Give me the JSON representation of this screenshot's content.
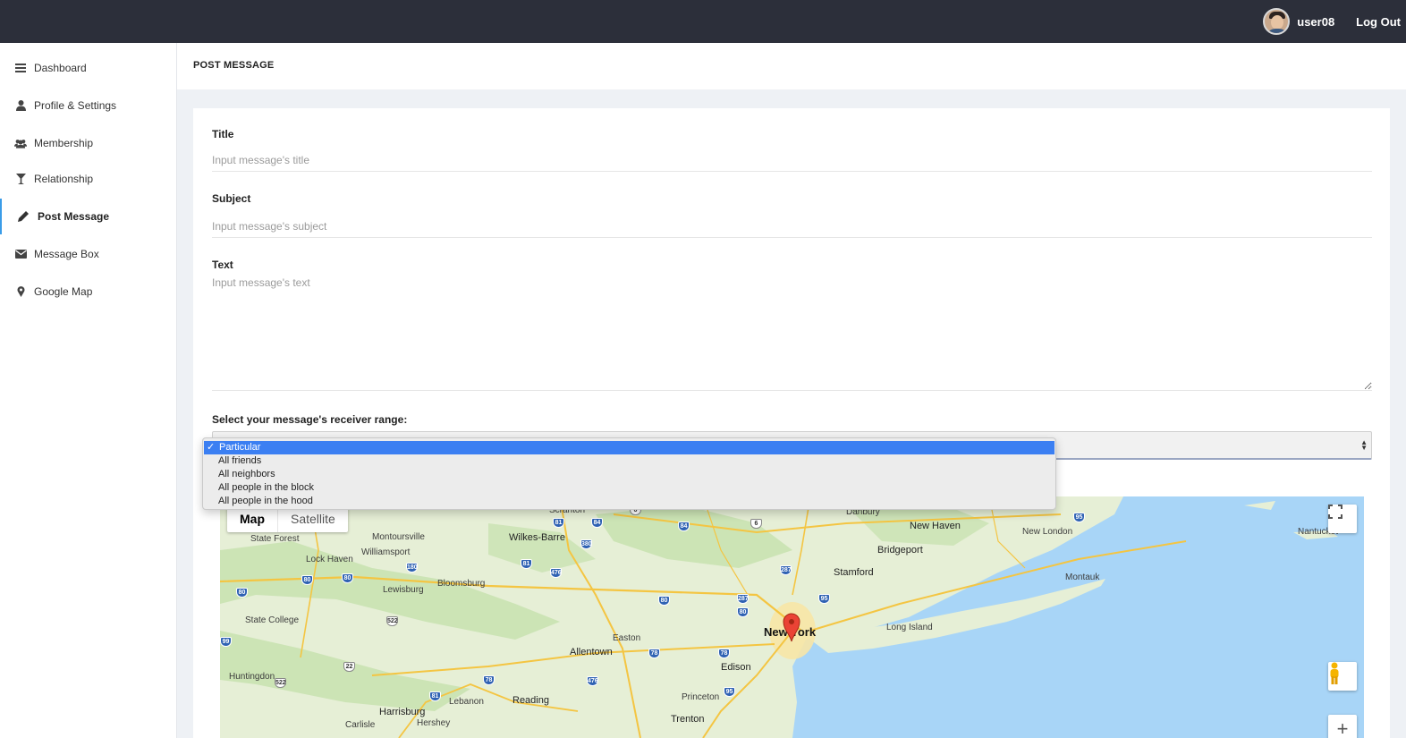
{
  "topbar": {
    "username": "user08",
    "logout_label": "Log Out"
  },
  "sidebar": {
    "items": [
      {
        "label": "Dashboard",
        "icon": "bars-icon"
      },
      {
        "label": "Profile & Settings",
        "icon": "user-icon"
      },
      {
        "label": "Membership",
        "icon": "users-icon"
      },
      {
        "label": "Relationship",
        "icon": "cocktail-icon"
      },
      {
        "label": "Post Message",
        "icon": "pencil-icon",
        "active": true
      },
      {
        "label": "Message Box",
        "icon": "envelope-icon"
      },
      {
        "label": "Google Map",
        "icon": "map-marker-icon"
      }
    ]
  },
  "header": {
    "title": "POST MESSAGE"
  },
  "form": {
    "title_label": "Title",
    "title_placeholder": "Input message's title",
    "subject_label": "Subject",
    "subject_placeholder": "Input message's subject",
    "text_label": "Text",
    "text_placeholder": "Input message's text",
    "range_label": "Select your message's receiver range:",
    "range_options": [
      "Particular",
      "All friends",
      "All neighbors",
      "All people in the block",
      "All people in the hood"
    ],
    "range_selected": "Particular"
  },
  "map": {
    "type_map": "Map",
    "type_satellite": "Satellite",
    "zoom_in": "+",
    "labels": {
      "state_forest": "State Forest",
      "montoursville": "Montoursville",
      "wilkes_barre": "Wilkes-Barre",
      "scranton": "Scranton",
      "danbury": "Danbury",
      "new_haven": "New Haven",
      "new_london": "New London",
      "nantucket": "Nantucket",
      "lock_haven": "Lock Haven",
      "williamsport": "Williamsport",
      "bridgeport": "Bridgeport",
      "stamford": "Stamford",
      "montauk": "Montauk",
      "lewisburg": "Lewisburg",
      "bloomsburg": "Bloomsburg",
      "state_college": "State College",
      "new_york": "New York",
      "long_island": "Long Island",
      "easton": "Easton",
      "allentown": "Allentown",
      "edison": "Edison",
      "huntingdon": "Huntingdon",
      "lebanon": "Lebanon",
      "reading": "Reading",
      "princeton": "Princeton",
      "harrisburg": "Harrisburg",
      "hershey": "Hershey",
      "carlisle": "Carlisle",
      "trenton": "Trenton"
    },
    "highways": [
      "81",
      "84",
      "6",
      "84",
      "6",
      "95",
      "80",
      "180",
      "476",
      "380",
      "80",
      "80",
      "81",
      "287",
      "95",
      "80",
      "80",
      "287",
      "522",
      "99",
      "22",
      "522",
      "78",
      "81",
      "476",
      "78",
      "78",
      "95"
    ],
    "colors": {
      "water": "#a8d5f7",
      "land": "#e6efd6",
      "forest": "#c9e2b1",
      "road": "#f4c542",
      "marker": "#ea4335"
    }
  }
}
